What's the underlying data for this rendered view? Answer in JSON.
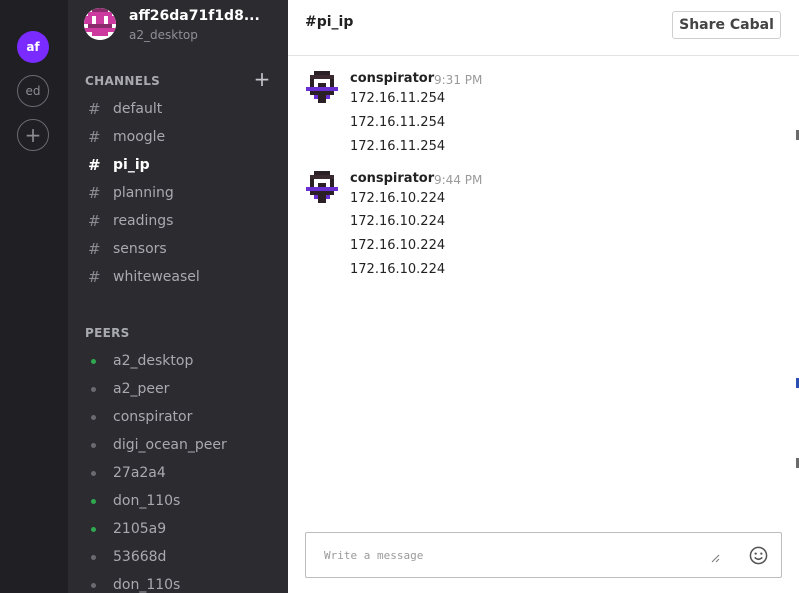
{
  "rail": {
    "items": [
      {
        "label": "af"
      },
      {
        "label": "ed"
      },
      {
        "label": "+"
      }
    ]
  },
  "sidebar": {
    "title": "aff26da71f1d8...",
    "subtitle": "a2_desktop",
    "channels_title": "CHANNELS",
    "channels": [
      {
        "label": "default"
      },
      {
        "label": "moogle"
      },
      {
        "label": "pi_ip",
        "active": true
      },
      {
        "label": "planning"
      },
      {
        "label": "readings"
      },
      {
        "label": "sensors"
      },
      {
        "label": "whiteweasel"
      }
    ],
    "peers_title": "PEERS",
    "peers": [
      {
        "label": "a2_desktop",
        "online": true
      },
      {
        "label": "a2_peer",
        "online": false
      },
      {
        "label": "conspirator",
        "online": false
      },
      {
        "label": "digi_ocean_peer",
        "online": false
      },
      {
        "label": "27a2a4",
        "online": false
      },
      {
        "label": "don_110s",
        "online": true
      },
      {
        "label": "2105a9",
        "online": true
      },
      {
        "label": "53668d",
        "online": false
      },
      {
        "label": "don_110s",
        "online": false
      }
    ]
  },
  "main": {
    "channel": "#pi_ip",
    "share_label": "Share Cabal",
    "messages": [
      {
        "author": "conspirator",
        "time": "9:31 PM",
        "lines": [
          "172.16.11.254",
          "172.16.11.254",
          "172.16.11.254"
        ]
      },
      {
        "author": "conspirator",
        "time": "9:44 PM",
        "lines": [
          "172.16.10.224",
          "172.16.10.224",
          "172.16.10.224",
          "172.16.10.224"
        ]
      }
    ],
    "composer_placeholder": "Write a message"
  },
  "colors": {
    "accent": "#7a2bff",
    "online": "#2fa84f",
    "rail_bg": "#1f1f24",
    "sidebar_bg": "#2b2b30"
  },
  "icons": {
    "add_channel": "plus-icon",
    "emoji": "smiley-icon",
    "channel": "hash-icon"
  }
}
